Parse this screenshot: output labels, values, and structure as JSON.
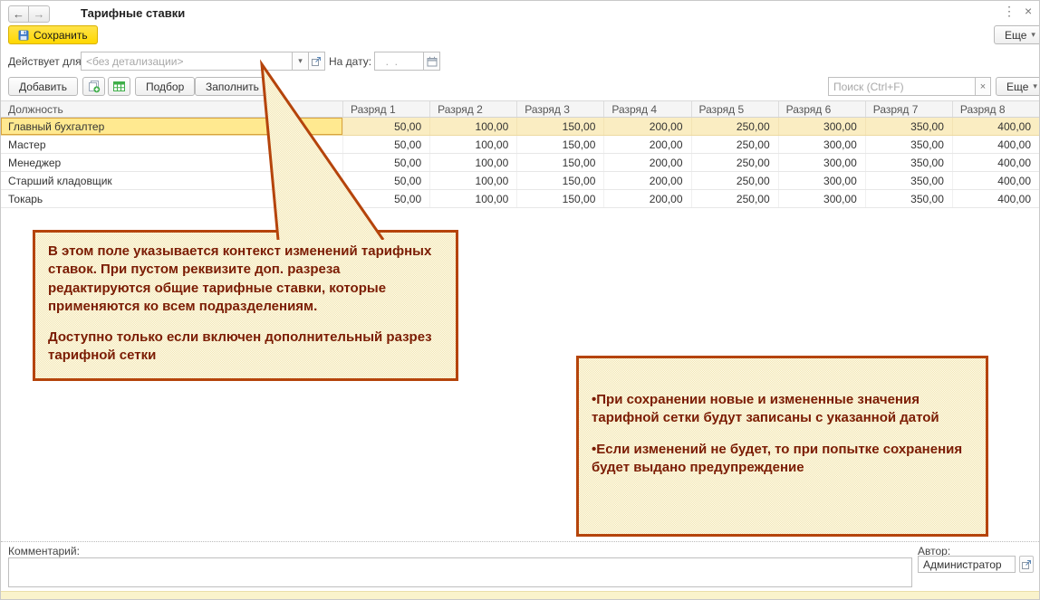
{
  "window": {
    "title": "Тарифные ставки",
    "more_label": "Еще"
  },
  "save_bar": {
    "save_label": "Сохранить"
  },
  "filter": {
    "acts_for_label": "Действует для:",
    "acts_for_placeholder": "<без детализации>",
    "on_date_label": "На дату:",
    "date_placeholder": "  .  ."
  },
  "toolbar": {
    "add_label": "Добавить",
    "pick_label": "Подбор",
    "fill_label": "Заполнить",
    "search_placeholder": "Поиск (Ctrl+F)",
    "more_label": "Еще"
  },
  "table": {
    "columns": [
      "Должность",
      "Разряд 1",
      "Разряд 2",
      "Разряд 3",
      "Разряд 4",
      "Разряд 5",
      "Разряд 6",
      "Разряд 7",
      "Разряд 8"
    ],
    "selected_row_index": 0,
    "rows": [
      {
        "position": "Главный бухгалтер",
        "values": [
          "50,00",
          "100,00",
          "150,00",
          "200,00",
          "250,00",
          "300,00",
          "350,00",
          "400,00"
        ]
      },
      {
        "position": "Мастер",
        "values": [
          "50,00",
          "100,00",
          "150,00",
          "200,00",
          "250,00",
          "300,00",
          "350,00",
          "400,00"
        ]
      },
      {
        "position": "Менеджер",
        "values": [
          "50,00",
          "100,00",
          "150,00",
          "200,00",
          "250,00",
          "300,00",
          "350,00",
          "400,00"
        ]
      },
      {
        "position": "Старший кладовщик",
        "values": [
          "50,00",
          "100,00",
          "150,00",
          "200,00",
          "250,00",
          "300,00",
          "350,00",
          "400,00"
        ]
      },
      {
        "position": "Токарь",
        "values": [
          "50,00",
          "100,00",
          "150,00",
          "200,00",
          "250,00",
          "300,00",
          "350,00",
          "400,00"
        ]
      }
    ]
  },
  "callouts": [
    {
      "paragraphs": [
        "В этом поле указывается контекст изменений тарифных ставок. При пустом реквизите доп. разреза редактируются общие тарифные ставки, которые применяются ко всем подразделениям.",
        "Доступно только если включен дополнительный разрез тарифной сетки"
      ]
    },
    {
      "paragraphs": [
        "•При сохранении новые и измененные значения тарифной сетки будут записаны с указанной датой",
        "•Если изменений не будет, то при попытке сохранения будет выдано предупреждение"
      ]
    }
  ],
  "footer": {
    "comment_label": "Комментарий:",
    "author_label": "Автор:",
    "author_value": "Администратор"
  },
  "icons": {
    "back": "←",
    "forward": "→",
    "kebab": "⋮",
    "close": "×",
    "caret_down": "▾",
    "clear": "×"
  },
  "colors": {
    "accent_yellow": "#ffd800",
    "callout_border": "#b5440b",
    "callout_text": "#7b1c03",
    "selection": "#ffe990"
  }
}
